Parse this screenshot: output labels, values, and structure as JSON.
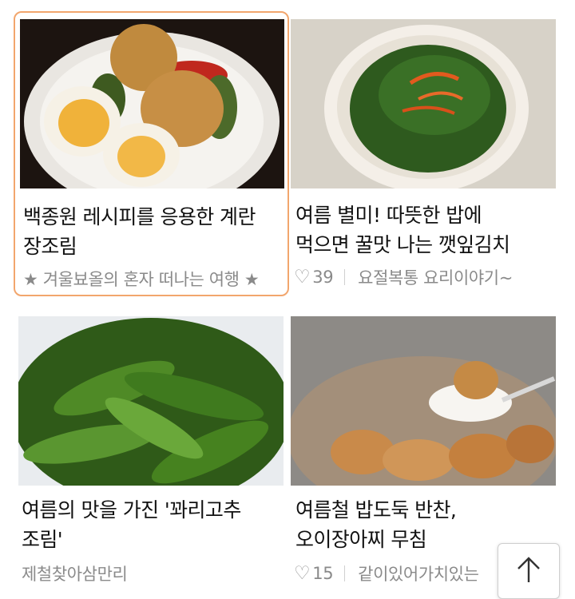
{
  "cards": [
    {
      "title": "백종원 레시피를 응용한 계란 장조림",
      "author": "★ 겨울뵤올의 혼자 떠나는 여행 ★",
      "likes": "",
      "highlighted": true
    },
    {
      "title": "여름 별미! 따뜻한 밥에 먹으면 꿀맛 나는 깻잎김치",
      "likes": "39",
      "author": "요절복통 요리이야기~",
      "highlighted": false
    },
    {
      "title": "여름의 맛을 가진 '꽈리고추 조림'",
      "author": "제철찾아삼만리",
      "likes": "",
      "highlighted": false
    },
    {
      "title": "여름철 밥도둑 반찬, 오이장아찌 무침",
      "likes": "15",
      "author": "같이있어가치있는",
      "highlighted": false
    }
  ],
  "icons": {
    "like": "heart-outline-icon",
    "scroll_top": "arrow-up-icon"
  },
  "colors": {
    "highlight_border": "#f2a66d",
    "meta_text": "#8a8a8a",
    "title_text": "#111111"
  }
}
